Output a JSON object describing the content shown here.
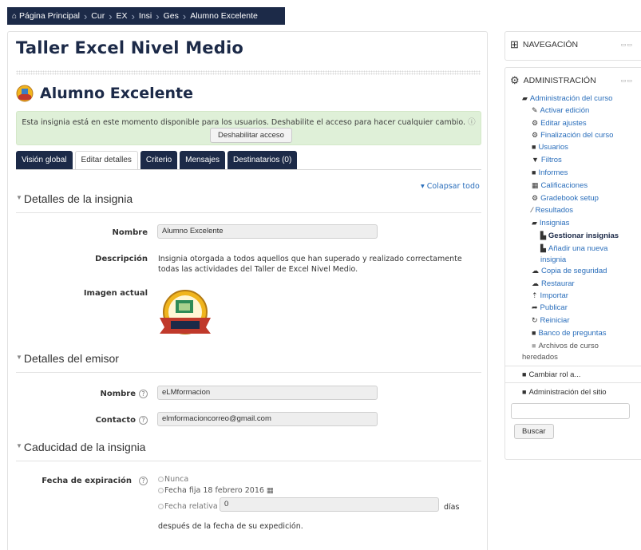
{
  "breadcrumb": {
    "items": [
      "Página Principal",
      "Cur",
      "EX",
      "Insi",
      "Ges",
      "Alumno Excelente"
    ]
  },
  "course": {
    "title": "Taller Excel Nivel Medio"
  },
  "badge": {
    "title": "Alumno Excelente",
    "notice": "Esta insignia está en este momento disponible para los usuarios. Deshabilite el acceso para hacer cualquier cambio.",
    "disable_button": "Deshabilitar acceso"
  },
  "tabs": [
    {
      "label": "Visión global",
      "active": false
    },
    {
      "label": "Editar detalles",
      "active": true
    },
    {
      "label": "Criterio",
      "active": false
    },
    {
      "label": "Mensajes",
      "active": false
    },
    {
      "label": "Destinatarios (0)",
      "active": false
    }
  ],
  "collapse_all": "Colapsar todo",
  "sections": {
    "badge_details": {
      "title": "Detalles de la insignia",
      "name_label": "Nombre",
      "name_value": "Alumno Excelente",
      "description_label": "Descripción",
      "description_value": "Insignia otorgada a todos aquellos que han superado y realizado correctamente todas las actividades del Taller de Excel Nivel Medio.",
      "image_label": "Imagen actual"
    },
    "issuer_details": {
      "title": "Detalles del emisor",
      "name_label": "Nombre",
      "name_value": "eLMformacion",
      "contact_label": "Contacto",
      "contact_value": "elmformacioncorreo@gmail.com"
    },
    "expiry": {
      "title": "Caducidad de la insignia",
      "date_label": "Fecha de expiración",
      "option_never": "Nunca",
      "option_fixed": "Fecha fija 18 febrero 2016",
      "option_relative": "Fecha relativa",
      "relative_value": "0",
      "days_label": "días",
      "after_text": "después de la fecha de su expedición."
    }
  },
  "navigation_block": {
    "title": "NAVEGACIÓN"
  },
  "admin_block": {
    "title": "ADMINISTRACIÓN",
    "items": [
      {
        "label": "Administración del curso",
        "icon": "folder-open-icon"
      },
      {
        "label": "Activar edición",
        "icon": "pencil-icon"
      },
      {
        "label": "Editar ajustes",
        "icon": "cogs-icon"
      },
      {
        "label": "Finalización del curso",
        "icon": "cogs-icon"
      },
      {
        "label": "Usuarios",
        "icon": "folder-icon"
      },
      {
        "label": "Filtros",
        "icon": "filter-icon"
      },
      {
        "label": "Informes",
        "icon": "folder-icon"
      },
      {
        "label": "Calificaciones",
        "icon": "table-icon"
      },
      {
        "label": "Gradebook setup",
        "icon": "cogs-icon"
      },
      {
        "label": "Resultados",
        "icon": "magic-icon"
      },
      {
        "label": "Insignias",
        "icon": "folder-open-icon"
      },
      {
        "label": "Gestionar insignias",
        "icon": "file-icon"
      },
      {
        "label": "Añadir una nueva",
        "icon": "file-icon"
      },
      {
        "label": "insignia",
        "icon": ""
      },
      {
        "label": "Copia de seguridad",
        "icon": "cloud-icon"
      },
      {
        "label": "Restaurar",
        "icon": "cloud-icon"
      },
      {
        "label": "Importar",
        "icon": "upload-icon"
      },
      {
        "label": "Publicar",
        "icon": "share-icon"
      },
      {
        "label": "Reiniciar",
        "icon": "refresh-icon"
      },
      {
        "label": "Banco de preguntas",
        "icon": "folder-icon"
      },
      {
        "label": "Archivos de curso",
        "icon": "folder-icon"
      },
      {
        "label": "heredados",
        "icon": ""
      }
    ],
    "switch_role": "Cambiar rol a...",
    "site_admin": "Administración del sitio",
    "search_button": "Buscar"
  }
}
